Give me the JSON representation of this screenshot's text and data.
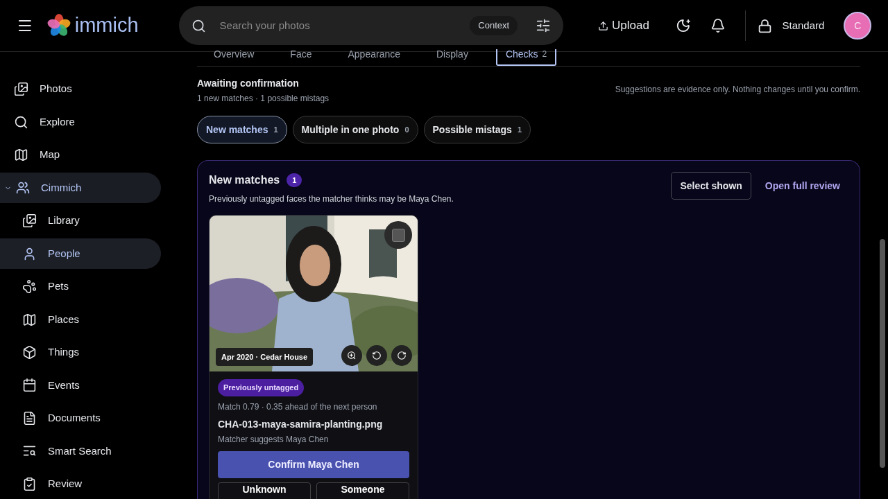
{
  "header": {
    "logo_text": "immich",
    "search_placeholder": "Search your photos",
    "context_label": "Context",
    "upload_label": "Upload",
    "mode_label": "Standard",
    "avatar_initial": "C"
  },
  "sidebar": {
    "items": [
      {
        "label": "Photos",
        "selected": false
      },
      {
        "label": "Explore",
        "selected": false
      },
      {
        "label": "Map",
        "selected": false
      },
      {
        "label": "Cimmich",
        "selected": false,
        "expanded": true,
        "children": [
          {
            "label": "Library",
            "selected": false
          },
          {
            "label": "People",
            "selected": true
          },
          {
            "label": "Pets",
            "selected": false
          },
          {
            "label": "Places",
            "selected": false
          },
          {
            "label": "Things",
            "selected": false
          },
          {
            "label": "Events",
            "selected": false
          },
          {
            "label": "Documents",
            "selected": false
          },
          {
            "label": "Smart Search",
            "selected": false
          },
          {
            "label": "Review",
            "selected": false
          }
        ]
      }
    ]
  },
  "tabs": [
    {
      "label": "Overview",
      "selected": false
    },
    {
      "label": "Face",
      "selected": false
    },
    {
      "label": "Appearance",
      "selected": false
    },
    {
      "label": "Display",
      "selected": false
    },
    {
      "label": "Checks",
      "count": "2",
      "selected": true
    }
  ],
  "summary": {
    "title": "Awaiting confirmation",
    "subtitle": "1 new matches · 1 possible mistags",
    "note": "Suggestions are evidence only. Nothing changes until you confirm."
  },
  "filters": [
    {
      "label": "New matches",
      "count": "1",
      "selected": true
    },
    {
      "label": "Multiple in one photo",
      "count": "0",
      "selected": false
    },
    {
      "label": "Possible mistags",
      "count": "1",
      "selected": false
    }
  ],
  "panel": {
    "title": "New matches",
    "count": "1",
    "description": "Previously untagged faces the matcher thinks may be Maya Chen.",
    "select_label": "Select shown",
    "review_link": "Open full review",
    "cards": [
      {
        "selected": false,
        "caption": "Apr 2020 · Cedar House",
        "badge": "Previously untagged",
        "match": "Match 0.79 · 0.35 ahead of the next person",
        "filename": "CHA-013-maya-samira-planting.png",
        "suggestion": "Matcher suggests Maya Chen",
        "confirm_label": "Confirm Maya Chen",
        "actions": [
          "Unknown",
          "Someone"
        ]
      }
    ]
  }
}
